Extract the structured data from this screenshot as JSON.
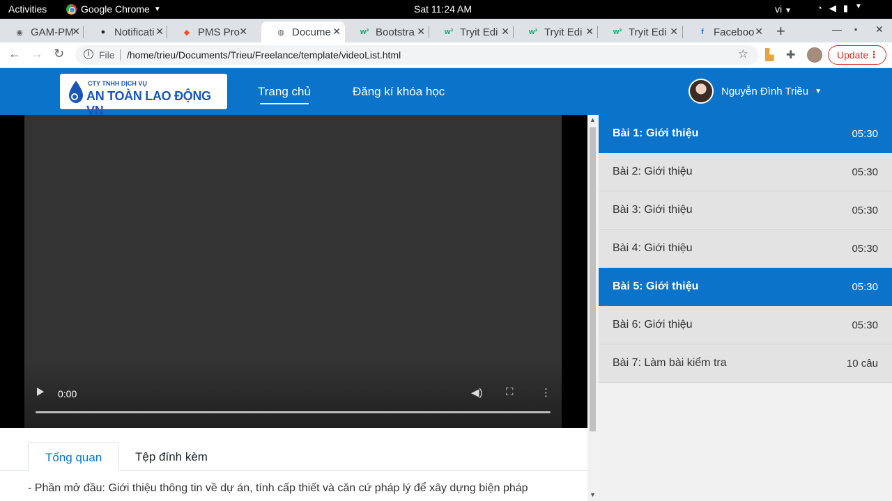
{
  "os": {
    "activities": "Activities",
    "app_name": "Google Chrome",
    "clock": "Sat 11:24 AM",
    "lang": "vi"
  },
  "browser": {
    "tabs": [
      {
        "title": "GAM-PM",
        "icon": "gitlab-icon"
      },
      {
        "title": "Notificati",
        "icon": "github-icon"
      },
      {
        "title": "PMS Pro",
        "icon": "figma-icon"
      },
      {
        "title": "Docume",
        "icon": "globe-icon"
      },
      {
        "title": "Bootstra",
        "icon": "w3schools-icon"
      },
      {
        "title": "Tryit Edi",
        "icon": "w3schools-icon"
      },
      {
        "title": "Tryit Edi",
        "icon": "w3schools-icon"
      },
      {
        "title": "Tryit Edi",
        "icon": "w3schools-icon"
      },
      {
        "title": "Faceboo",
        "icon": "facebook-icon"
      }
    ],
    "active_tab_index": 3,
    "file_label": "File",
    "url": "/home/trieu/Documents/Trieu/Freelance/template/videoList.html",
    "update_label": "Update"
  },
  "site": {
    "logo_small": "CTY TNHH DỊCH VỤ",
    "logo_big": "AN TOÀN LAO ĐỘNG VN",
    "nav": [
      "Trang chủ",
      "Đăng kí khóa học"
    ],
    "active_nav_index": 0,
    "user_name": "Nguyễn Đình Triều",
    "brand_color": "#0b73c9"
  },
  "video": {
    "time": "0:00"
  },
  "content_tabs": [
    "Tổng quan",
    "Tệp đính kèm"
  ],
  "active_content_tab": 0,
  "description": "- Phần mở đầu: Giới thiệu thông tin về dự án, tính cấp thiết và căn cứ pháp lý để xây dựng biện pháp",
  "lessons": [
    {
      "name": "Bài 1: Giới thiệu",
      "duration": "05:30",
      "active": true
    },
    {
      "name": "Bài 2: Giới thiệu",
      "duration": "05:30",
      "active": false
    },
    {
      "name": "Bài 3: Giới thiệu",
      "duration": "05:30",
      "active": false
    },
    {
      "name": "Bài 4: Giới thiệu",
      "duration": "05:30",
      "active": false
    },
    {
      "name": "Bài 5: Giới thiệu",
      "duration": "05:30",
      "active": true
    },
    {
      "name": "Bài 6: Giới thiệu",
      "duration": "05:30",
      "active": false
    },
    {
      "name": "Bài 7: Làm bài kiểm tra",
      "duration": "10 câu",
      "active": false
    }
  ]
}
